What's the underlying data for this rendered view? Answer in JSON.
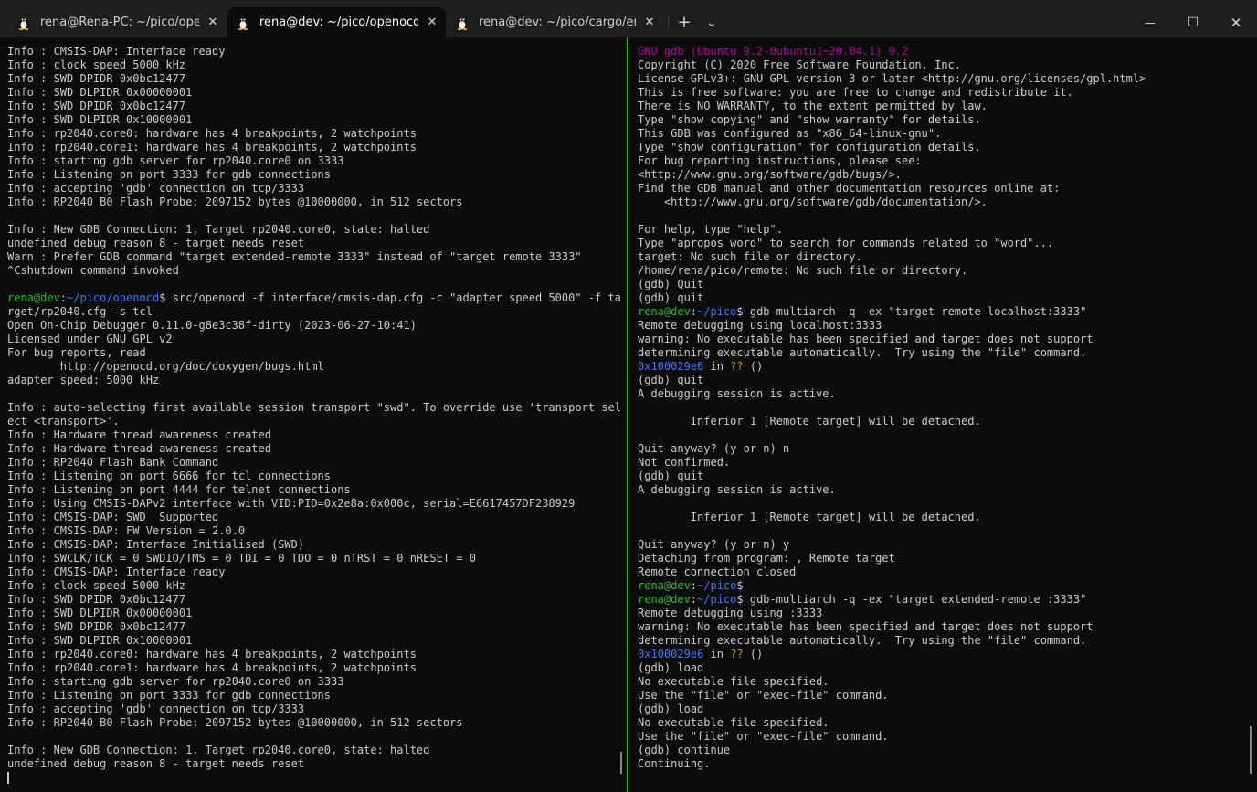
{
  "tabs": [
    {
      "title": "rena@Rena-PC: ~/pico/openocd",
      "active": false,
      "icon": "linux-tux-icon"
    },
    {
      "title": "rena@dev: ~/pico/openocd",
      "active": true,
      "icon": "linux-tux-icon"
    },
    {
      "title": "rena@dev: ~/pico/cargo/embassy",
      "active": false,
      "icon": "linux-tux-icon"
    }
  ],
  "tabbar": {
    "close_glyph": "✕",
    "new_tab_glyph": "+",
    "dropdown_glyph": "⌄"
  },
  "window_controls": {
    "minimize": "—",
    "maximize": "☐",
    "close": "✕"
  },
  "colors": {
    "prompt_user": "#16c60c",
    "prompt_path": "#3b78ff",
    "gdb_banner": "#b4009e",
    "question": "#c19c00",
    "text": "#cccccc",
    "background": "#0c0c0c",
    "active_pane_border": "#16c60c"
  },
  "left_pane": {
    "lines": [
      [
        {
          "t": "Info : CMSIS-DAP: Interface ready"
        }
      ],
      [
        {
          "t": "Info : clock speed 5000 kHz"
        }
      ],
      [
        {
          "t": "Info : SWD DPIDR 0x0bc12477"
        }
      ],
      [
        {
          "t": "Info : SWD DLPIDR 0x00000001"
        }
      ],
      [
        {
          "t": "Info : SWD DPIDR 0x0bc12477"
        }
      ],
      [
        {
          "t": "Info : SWD DLPIDR 0x10000001"
        }
      ],
      [
        {
          "t": "Info : rp2040.core0: hardware has 4 breakpoints, 2 watchpoints"
        }
      ],
      [
        {
          "t": "Info : rp2040.core1: hardware has 4 breakpoints, 2 watchpoints"
        }
      ],
      [
        {
          "t": "Info : starting gdb server for rp2040.core0 on 3333"
        }
      ],
      [
        {
          "t": "Info : Listening on port 3333 for gdb connections"
        }
      ],
      [
        {
          "t": "Info : accepting 'gdb' connection on tcp/3333"
        }
      ],
      [
        {
          "t": "Info : RP2040 B0 Flash Probe: 2097152 bytes @10000000, in 512 sectors"
        }
      ],
      [
        {
          "t": ""
        }
      ],
      [
        {
          "t": "Info : New GDB Connection: 1, Target rp2040.core0, state: halted"
        }
      ],
      [
        {
          "t": "undefined debug reason 8 - target needs reset"
        }
      ],
      [
        {
          "t": "Warn : Prefer GDB command \"target extended-remote 3333\" instead of \"target remote 3333\""
        }
      ],
      [
        {
          "t": "^Cshutdown command invoked"
        }
      ],
      [
        {
          "t": ""
        }
      ],
      [
        {
          "t": "rena@dev",
          "c": "g"
        },
        {
          "t": ":"
        },
        {
          "t": "~/pico/openocd",
          "c": "b"
        },
        {
          "t": "$ src/openocd -f interface/cmsis-dap.cfg -c \"adapter speed 5000\" -f ta"
        }
      ],
      [
        {
          "t": "rget/rp2040.cfg -s tcl"
        }
      ],
      [
        {
          "t": "Open On-Chip Debugger 0.11.0-g8e3c38f-dirty (2023-06-27-10:41)"
        }
      ],
      [
        {
          "t": "Licensed under GNU GPL v2"
        }
      ],
      [
        {
          "t": "For bug reports, read"
        }
      ],
      [
        {
          "t": "        http://openocd.org/doc/doxygen/bugs.html"
        }
      ],
      [
        {
          "t": "adapter speed: 5000 kHz"
        }
      ],
      [
        {
          "t": ""
        }
      ],
      [
        {
          "t": "Info : auto-selecting first available session transport \"swd\". To override use 'transport sel"
        }
      ],
      [
        {
          "t": "ect <transport>'."
        }
      ],
      [
        {
          "t": "Info : Hardware thread awareness created"
        }
      ],
      [
        {
          "t": "Info : Hardware thread awareness created"
        }
      ],
      [
        {
          "t": "Info : RP2040 Flash Bank Command"
        }
      ],
      [
        {
          "t": "Info : Listening on port 6666 for tcl connections"
        }
      ],
      [
        {
          "t": "Info : Listening on port 4444 for telnet connections"
        }
      ],
      [
        {
          "t": "Info : Using CMSIS-DAPv2 interface with VID:PID=0x2e8a:0x000c, serial=E6617457DF238929"
        }
      ],
      [
        {
          "t": "Info : CMSIS-DAP: SWD  Supported"
        }
      ],
      [
        {
          "t": "Info : CMSIS-DAP: FW Version = 2.0.0"
        }
      ],
      [
        {
          "t": "Info : CMSIS-DAP: Interface Initialised (SWD)"
        }
      ],
      [
        {
          "t": "Info : SWCLK/TCK = 0 SWDIO/TMS = 0 TDI = 0 TDO = 0 nTRST = 0 nRESET = 0"
        }
      ],
      [
        {
          "t": "Info : CMSIS-DAP: Interface ready"
        }
      ],
      [
        {
          "t": "Info : clock speed 5000 kHz"
        }
      ],
      [
        {
          "t": "Info : SWD DPIDR 0x0bc12477"
        }
      ],
      [
        {
          "t": "Info : SWD DLPIDR 0x00000001"
        }
      ],
      [
        {
          "t": "Info : SWD DPIDR 0x0bc12477"
        }
      ],
      [
        {
          "t": "Info : SWD DLPIDR 0x10000001"
        }
      ],
      [
        {
          "t": "Info : rp2040.core0: hardware has 4 breakpoints, 2 watchpoints"
        }
      ],
      [
        {
          "t": "Info : rp2040.core1: hardware has 4 breakpoints, 2 watchpoints"
        }
      ],
      [
        {
          "t": "Info : starting gdb server for rp2040.core0 on 3333"
        }
      ],
      [
        {
          "t": "Info : Listening on port 3333 for gdb connections"
        }
      ],
      [
        {
          "t": "Info : accepting 'gdb' connection on tcp/3333"
        }
      ],
      [
        {
          "t": "Info : RP2040 B0 Flash Probe: 2097152 bytes @10000000, in 512 sectors"
        }
      ],
      [
        {
          "t": ""
        }
      ],
      [
        {
          "t": "Info : New GDB Connection: 1, Target rp2040.core0, state: halted"
        }
      ],
      [
        {
          "t": "undefined debug reason 8 - target needs reset"
        }
      ],
      [
        {
          "t": "",
          "cursor": true
        }
      ]
    ]
  },
  "right_pane": {
    "lines": [
      [
        {
          "t": "GNU gdb (Ubuntu 9.2-0ubuntu1~20.04.1) 9.2",
          "c": "m"
        }
      ],
      [
        {
          "t": "Copyright (C) 2020 Free Software Foundation, Inc."
        }
      ],
      [
        {
          "t": "License GPLv3+: GNU GPL version 3 or later <http://gnu.org/licenses/gpl.html>"
        }
      ],
      [
        {
          "t": "This is free software: you are free to change and redistribute it."
        }
      ],
      [
        {
          "t": "There is NO WARRANTY, to the extent permitted by law."
        }
      ],
      [
        {
          "t": "Type \"show copying\" and \"show warranty\" for details."
        }
      ],
      [
        {
          "t": "This GDB was configured as \"x86_64-linux-gnu\"."
        }
      ],
      [
        {
          "t": "Type \"show configuration\" for configuration details."
        }
      ],
      [
        {
          "t": "For bug reporting instructions, please see:"
        }
      ],
      [
        {
          "t": "<http://www.gnu.org/software/gdb/bugs/>."
        }
      ],
      [
        {
          "t": "Find the GDB manual and other documentation resources online at:"
        }
      ],
      [
        {
          "t": "    <http://www.gnu.org/software/gdb/documentation/>."
        }
      ],
      [
        {
          "t": ""
        }
      ],
      [
        {
          "t": "For help, type \"help\"."
        }
      ],
      [
        {
          "t": "Type \"apropos word\" to search for commands related to \"word\"..."
        }
      ],
      [
        {
          "t": "target: No such file or directory."
        }
      ],
      [
        {
          "t": "/home/rena/pico/remote: No such file or directory."
        }
      ],
      [
        {
          "t": "(gdb) Quit"
        }
      ],
      [
        {
          "t": "(gdb) quit"
        }
      ],
      [
        {
          "t": "rena@dev",
          "c": "g"
        },
        {
          "t": ":"
        },
        {
          "t": "~/pico",
          "c": "b"
        },
        {
          "t": "$ gdb-multiarch -q -ex \"target remote localhost:3333\""
        }
      ],
      [
        {
          "t": "Remote debugging using localhost:3333"
        }
      ],
      [
        {
          "t": "warning: No executable has been specified and target does not support"
        }
      ],
      [
        {
          "t": "determining executable automatically.  Try using the \"file\" command."
        }
      ],
      [
        {
          "t": "0x100029e6",
          "c": "b"
        },
        {
          "t": " in "
        },
        {
          "t": "??",
          "c": "y"
        },
        {
          "t": " ()"
        }
      ],
      [
        {
          "t": "(gdb) quit"
        }
      ],
      [
        {
          "t": "A debugging session is active."
        }
      ],
      [
        {
          "t": ""
        }
      ],
      [
        {
          "t": "        Inferior 1 [Remote target] will be detached."
        }
      ],
      [
        {
          "t": ""
        }
      ],
      [
        {
          "t": "Quit anyway? (y or n) n"
        }
      ],
      [
        {
          "t": "Not confirmed."
        }
      ],
      [
        {
          "t": "(gdb) quit"
        }
      ],
      [
        {
          "t": "A debugging session is active."
        }
      ],
      [
        {
          "t": ""
        }
      ],
      [
        {
          "t": "        Inferior 1 [Remote target] will be detached."
        }
      ],
      [
        {
          "t": ""
        }
      ],
      [
        {
          "t": "Quit anyway? (y or n) y"
        }
      ],
      [
        {
          "t": "Detaching from program: , Remote target"
        }
      ],
      [
        {
          "t": "Remote connection closed"
        }
      ],
      [
        {
          "t": "rena@dev",
          "c": "g"
        },
        {
          "t": ":"
        },
        {
          "t": "~/pico",
          "c": "b"
        },
        {
          "t": "$"
        }
      ],
      [
        {
          "t": "rena@dev",
          "c": "g"
        },
        {
          "t": ":"
        },
        {
          "t": "~/pico",
          "c": "b"
        },
        {
          "t": "$ gdb-multiarch -q -ex \"target extended-remote :3333\""
        }
      ],
      [
        {
          "t": "Remote debugging using :3333"
        }
      ],
      [
        {
          "t": "warning: No executable has been specified and target does not support"
        }
      ],
      [
        {
          "t": "determining executable automatically.  Try using the \"file\" command."
        }
      ],
      [
        {
          "t": "0x100029e6",
          "c": "b"
        },
        {
          "t": " in "
        },
        {
          "t": "??",
          "c": "y"
        },
        {
          "t": " ()"
        }
      ],
      [
        {
          "t": "(gdb) load"
        }
      ],
      [
        {
          "t": "No executable file specified."
        }
      ],
      [
        {
          "t": "Use the \"file\" or \"exec-file\" command."
        }
      ],
      [
        {
          "t": "(gdb) load"
        }
      ],
      [
        {
          "t": "No executable file specified."
        }
      ],
      [
        {
          "t": "Use the \"file\" or \"exec-file\" command."
        }
      ],
      [
        {
          "t": "(gdb) continue"
        }
      ],
      [
        {
          "t": "Continuing."
        }
      ]
    ]
  }
}
